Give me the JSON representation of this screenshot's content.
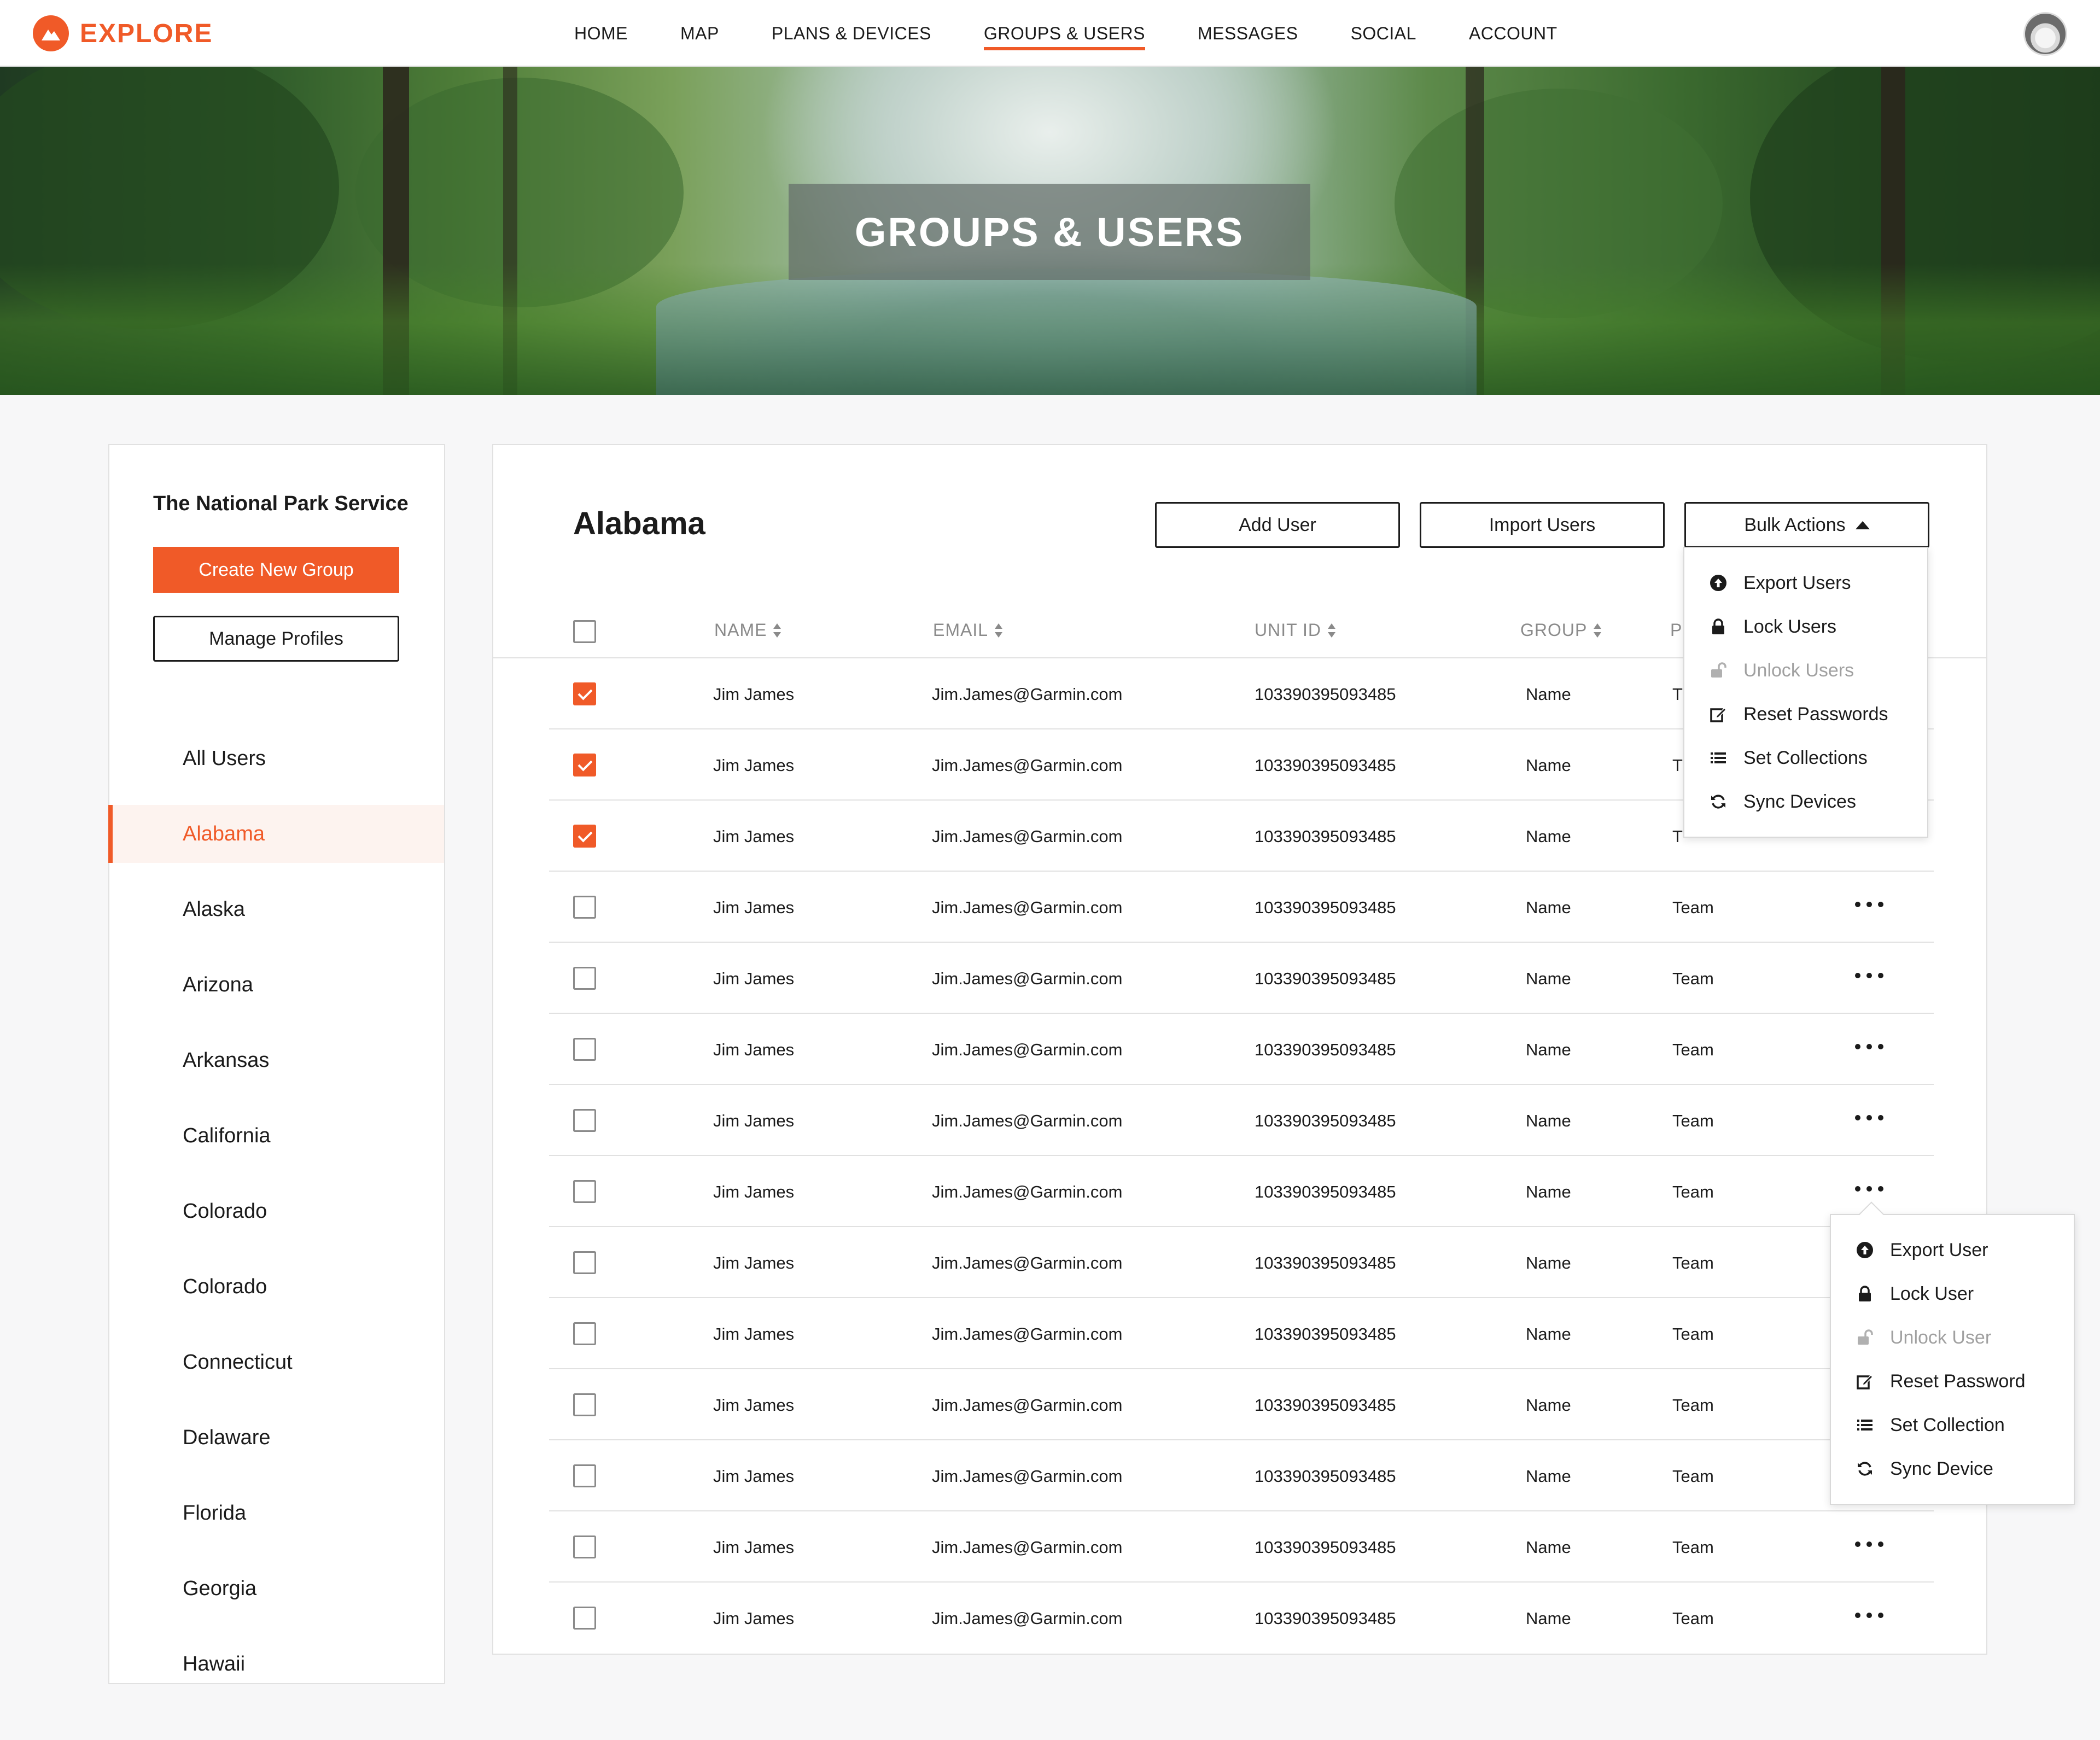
{
  "brand": {
    "name": "EXPLORE",
    "accent": "#f05a28"
  },
  "nav": {
    "items": [
      {
        "label": "HOME",
        "active": false
      },
      {
        "label": "MAP",
        "active": false
      },
      {
        "label": "PLANS & DEVICES",
        "active": false
      },
      {
        "label": "GROUPS & USERS",
        "active": true
      },
      {
        "label": "MESSAGES",
        "active": false
      },
      {
        "label": "SOCIAL",
        "active": false
      },
      {
        "label": "ACCOUNT",
        "active": false
      }
    ]
  },
  "hero": {
    "title": "GROUPS & USERS"
  },
  "sidebar": {
    "org_name": "The National Park Service",
    "create_group_label": "Create New Group",
    "manage_profiles_label": "Manage Profiles",
    "items": [
      {
        "label": "All Users",
        "active": false
      },
      {
        "label": "Alabama",
        "active": true
      },
      {
        "label": "Alaska",
        "active": false
      },
      {
        "label": "Arizona",
        "active": false
      },
      {
        "label": "Arkansas",
        "active": false
      },
      {
        "label": "California",
        "active": false
      },
      {
        "label": "Colorado",
        "active": false
      },
      {
        "label": "Colorado",
        "active": false
      },
      {
        "label": "Connecticut",
        "active": false
      },
      {
        "label": "Delaware",
        "active": false
      },
      {
        "label": "Florida",
        "active": false
      },
      {
        "label": "Georgia",
        "active": false
      },
      {
        "label": "Hawaii",
        "active": false
      }
    ]
  },
  "main": {
    "title": "Alabama",
    "add_user_label": "Add User",
    "import_users_label": "Import Users",
    "bulk_actions_label": "Bulk Actions",
    "columns": {
      "name": "NAME",
      "email": "EMAIL",
      "unit_id": "UNIT ID",
      "group": "GROUP",
      "p_partial": "P"
    },
    "rows": [
      {
        "checked": true,
        "name": "Jim James",
        "email": "Jim.James@Garmin.com",
        "unit_id": "103390395093485",
        "group": "Name",
        "team": "T"
      },
      {
        "checked": true,
        "name": "Jim James",
        "email": "Jim.James@Garmin.com",
        "unit_id": "103390395093485",
        "group": "Name",
        "team": "T"
      },
      {
        "checked": true,
        "name": "Jim James",
        "email": "Jim.James@Garmin.com",
        "unit_id": "103390395093485",
        "group": "Name",
        "team": "T"
      },
      {
        "checked": false,
        "name": "Jim James",
        "email": "Jim.James@Garmin.com",
        "unit_id": "103390395093485",
        "group": "Name",
        "team": "Team"
      },
      {
        "checked": false,
        "name": "Jim James",
        "email": "Jim.James@Garmin.com",
        "unit_id": "103390395093485",
        "group": "Name",
        "team": "Team"
      },
      {
        "checked": false,
        "name": "Jim James",
        "email": "Jim.James@Garmin.com",
        "unit_id": "103390395093485",
        "group": "Name",
        "team": "Team"
      },
      {
        "checked": false,
        "name": "Jim James",
        "email": "Jim.James@Garmin.com",
        "unit_id": "103390395093485",
        "group": "Name",
        "team": "Team"
      },
      {
        "checked": false,
        "name": "Jim James",
        "email": "Jim.James@Garmin.com",
        "unit_id": "103390395093485",
        "group": "Name",
        "team": "Team"
      },
      {
        "checked": false,
        "name": "Jim James",
        "email": "Jim.James@Garmin.com",
        "unit_id": "103390395093485",
        "group": "Name",
        "team": "Team"
      },
      {
        "checked": false,
        "name": "Jim James",
        "email": "Jim.James@Garmin.com",
        "unit_id": "103390395093485",
        "group": "Name",
        "team": "Team"
      },
      {
        "checked": false,
        "name": "Jim James",
        "email": "Jim.James@Garmin.com",
        "unit_id": "103390395093485",
        "group": "Name",
        "team": "Team"
      },
      {
        "checked": false,
        "name": "Jim James",
        "email": "Jim.James@Garmin.com",
        "unit_id": "103390395093485",
        "group": "Name",
        "team": "Team"
      },
      {
        "checked": false,
        "name": "Jim James",
        "email": "Jim.James@Garmin.com",
        "unit_id": "103390395093485",
        "group": "Name",
        "team": "Team"
      },
      {
        "checked": false,
        "name": "Jim James",
        "email": "Jim.James@Garmin.com",
        "unit_id": "103390395093485",
        "group": "Name",
        "team": "Team"
      }
    ]
  },
  "bulk_menu": {
    "items": [
      {
        "label": "Export Users",
        "icon": "upload-icon",
        "disabled": false
      },
      {
        "label": "Lock Users",
        "icon": "lock-icon",
        "disabled": false
      },
      {
        "label": "Unlock Users",
        "icon": "unlock-icon",
        "disabled": true
      },
      {
        "label": "Reset Passwords",
        "icon": "edit-icon",
        "disabled": false
      },
      {
        "label": "Set Collections",
        "icon": "list-icon",
        "disabled": false
      },
      {
        "label": "Sync Devices",
        "icon": "sync-icon",
        "disabled": false
      }
    ]
  },
  "row_menu": {
    "items": [
      {
        "label": "Export User",
        "icon": "upload-icon",
        "disabled": false
      },
      {
        "label": "Lock User",
        "icon": "lock-icon",
        "disabled": false
      },
      {
        "label": "Unlock User",
        "icon": "unlock-icon",
        "disabled": true
      },
      {
        "label": "Reset Password",
        "icon": "edit-icon",
        "disabled": false
      },
      {
        "label": "Set Collection",
        "icon": "list-icon",
        "disabled": false
      },
      {
        "label": "Sync Device",
        "icon": "sync-icon",
        "disabled": false
      }
    ]
  }
}
